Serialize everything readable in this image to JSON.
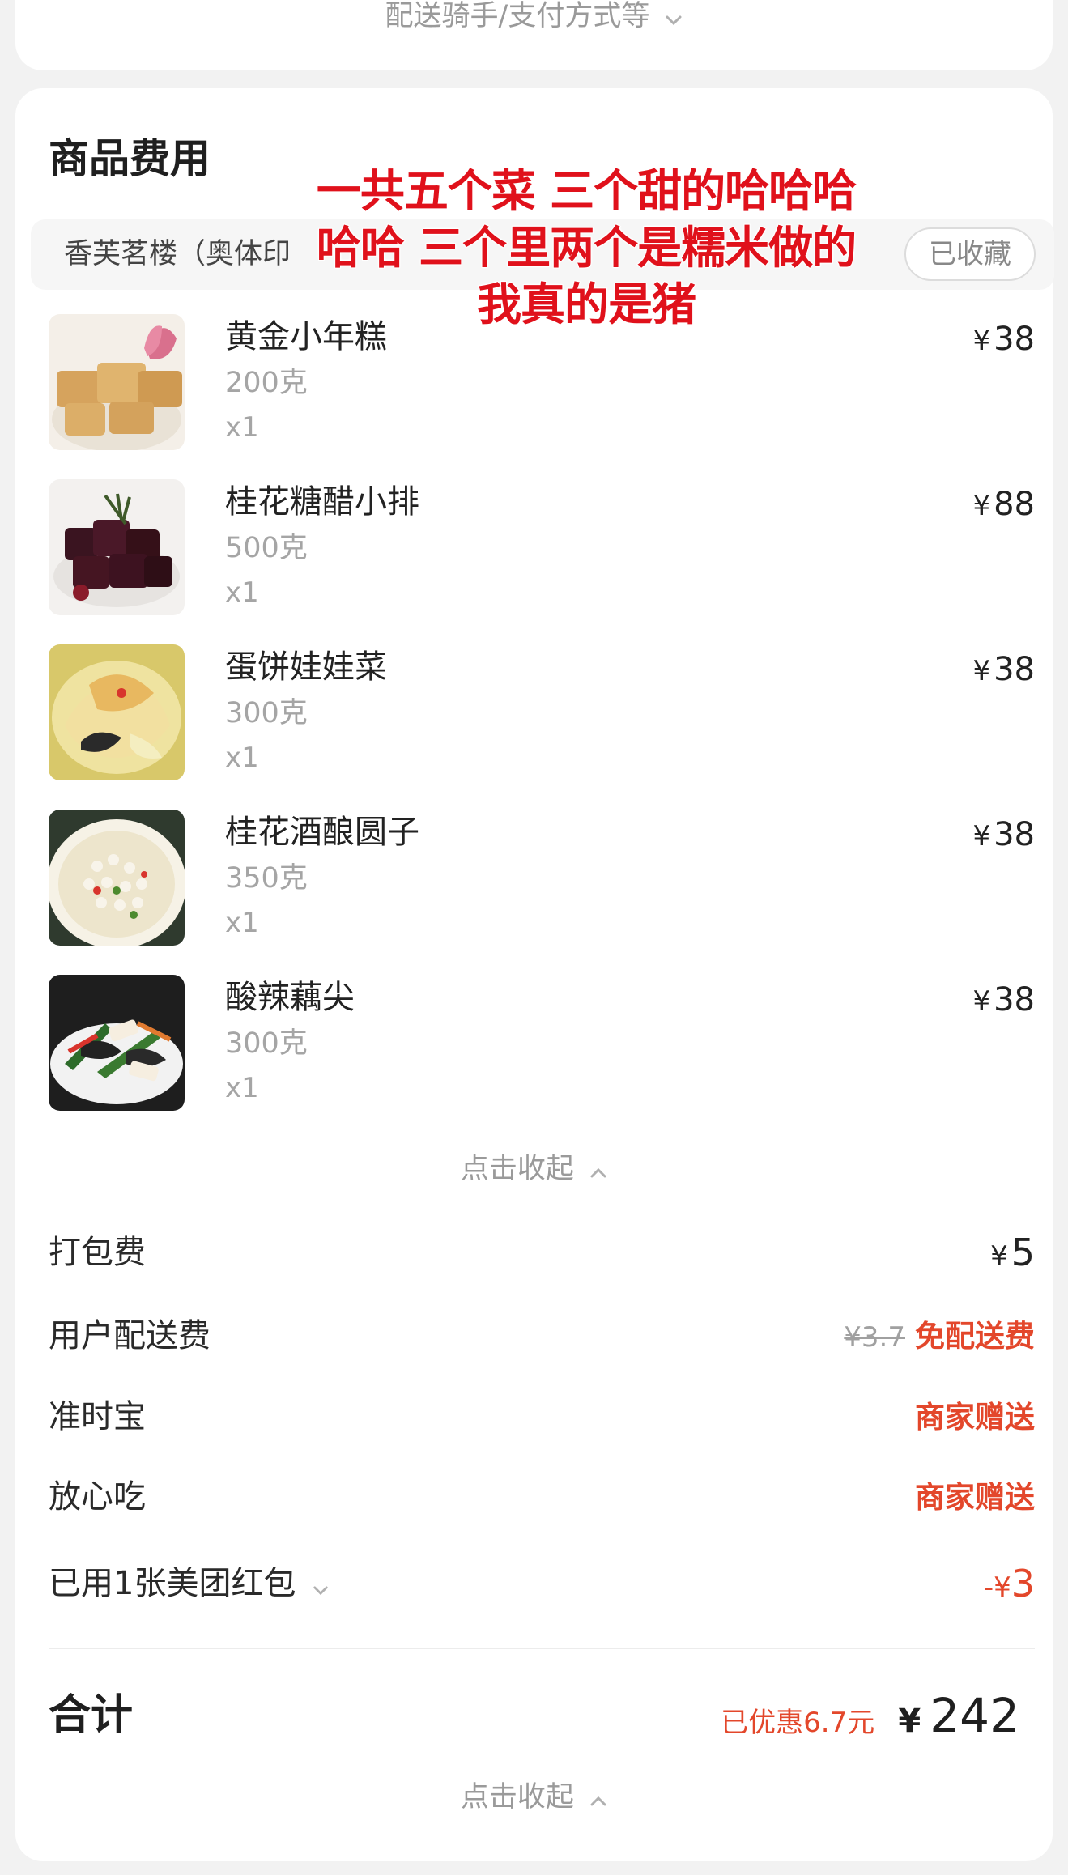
{
  "top": {
    "link_label": "配送骑手/支付方式等"
  },
  "section": {
    "title": "商品费用"
  },
  "store": {
    "name": "香芙茗楼（奥体印",
    "fav_label": "已收藏"
  },
  "overlay": {
    "line1": "一共五个菜 三个甜的哈哈哈",
    "line2": "哈哈 三个里两个是糯米做的",
    "line3": "我真的是猪"
  },
  "currency": "¥",
  "items": [
    {
      "name": "黄金小年糕",
      "weight": "200克",
      "qty": "x1",
      "price": "38"
    },
    {
      "name": "桂花糖醋小排",
      "weight": "500克",
      "qty": "x1",
      "price": "88"
    },
    {
      "name": "蛋饼娃娃菜",
      "weight": "300克",
      "qty": "x1",
      "price": "38"
    },
    {
      "name": "桂花酒酿圆子",
      "weight": "350克",
      "qty": "x1",
      "price": "38"
    },
    {
      "name": "酸辣藕尖",
      "weight": "300克",
      "qty": "x1",
      "price": "38"
    }
  ],
  "collapse_label": "点击收起",
  "fees": {
    "packing": {
      "label": "打包费",
      "value": "5"
    },
    "delivery": {
      "label": "用户配送费",
      "original": "¥3.7",
      "value": "免配送费"
    },
    "ontime": {
      "label": "准时宝",
      "value": "商家赠送"
    },
    "safe_eat": {
      "label": "放心吃",
      "value": "商家赠送"
    },
    "coupon": {
      "label": "已用1张美团红包",
      "value_prefix": "-¥",
      "value": "3"
    }
  },
  "total": {
    "label": "合计",
    "saved": "已优惠6.7元",
    "amount": "242"
  },
  "colors": {
    "accent_red": "#e3472b",
    "overlay_red": "#e0111b"
  }
}
